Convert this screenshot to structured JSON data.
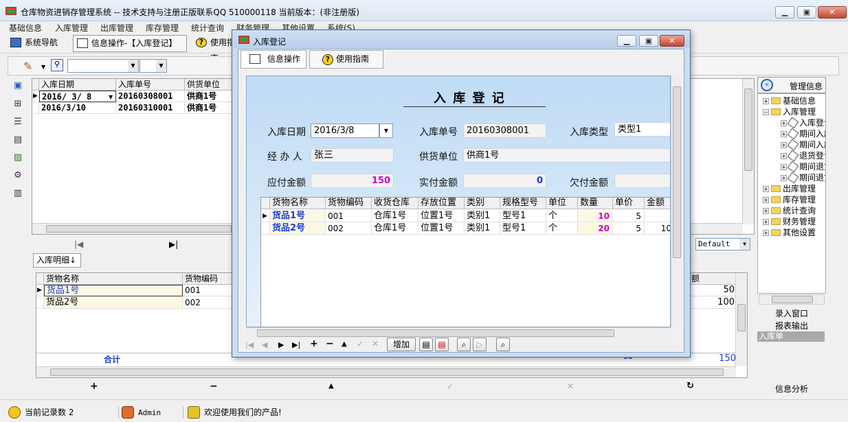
{
  "app": {
    "title": "仓库物资进销存管理系统 -- 技术支持与注册正版联系QQ 510000118   当前版本：(非注册版)"
  },
  "menu": [
    "基础信息",
    "入库管理",
    "出库管理",
    "库存管理",
    "统计查询",
    "财务管理",
    "其他设置",
    "系统(S)"
  ],
  "tabs": {
    "nav": "系统导航",
    "info": "信息操作-【入库登记】",
    "guide": "使用指南"
  },
  "master": {
    "headers": [
      "入库日期",
      "入库单号",
      "供货单位"
    ],
    "rows": [
      {
        "date": "2016/ 3/ 8",
        "no": "20160308001",
        "supplier": "供商1号"
      },
      {
        "date": "2016/3/10",
        "no": "20160310001",
        "supplier": "供商1号"
      }
    ]
  },
  "layout_select": {
    "value": "Default"
  },
  "detail": {
    "tab": "入库明细↓",
    "headers": [
      "货物名称",
      "货物编码",
      "额"
    ],
    "rows": [
      {
        "name": "货品1号",
        "code": "001",
        "amount": "50"
      },
      {
        "name": "货品2号",
        "code": "002",
        "amount": "100"
      }
    ],
    "total_label": "合计",
    "total_value": "150",
    "total_partial": "30"
  },
  "right_panel": {
    "title": "管理信息",
    "tree": [
      {
        "label": "基础信息",
        "level": 0,
        "type": "folder"
      },
      {
        "label": "入库管理",
        "level": 0,
        "type": "folder"
      },
      {
        "label": "入库登记",
        "level": 1,
        "type": "doc"
      },
      {
        "label": "期间入库",
        "level": 1,
        "type": "doc"
      },
      {
        "label": "期间入库",
        "level": 1,
        "type": "doc"
      },
      {
        "label": "退货登记",
        "level": 1,
        "type": "doc"
      },
      {
        "label": "期间退货",
        "level": 1,
        "type": "doc"
      },
      {
        "label": "期间退货",
        "level": 1,
        "type": "doc"
      },
      {
        "label": "出库管理",
        "level": 0,
        "type": "folder"
      },
      {
        "label": "库存管理",
        "level": 0,
        "type": "folder"
      },
      {
        "label": "统计查询",
        "level": 0,
        "type": "folder"
      },
      {
        "label": "财务管理",
        "level": 0,
        "type": "folder"
      },
      {
        "label": "其他设置",
        "level": 0,
        "type": "folder"
      }
    ],
    "buttons": [
      "录入窗口",
      "报表输出"
    ],
    "selected": "入库单",
    "bottom": "信息分析"
  },
  "status": {
    "records": "当前记录数 2",
    "user": "Admin",
    "welcome": "欢迎使用我们的产品!"
  },
  "dialog": {
    "title": "入库登记",
    "tab_info": "信息操作",
    "tab_guide": "使用指南",
    "form_title": "入 库 登 记",
    "labels": {
      "date": "入库日期",
      "no": "入库单号",
      "type": "入库类型",
      "handler": "经 办 人",
      "supplier": "供货单位",
      "payable": "应付金额",
      "paid": "实付金额",
      "owed": "欠付金额"
    },
    "values": {
      "date": "2016/3/8",
      "no": "20160308001",
      "type": "类型1",
      "handler": "张三",
      "supplier": "供商1号",
      "payable": "150",
      "paid": "0",
      "owed": ""
    },
    "grid_headers": [
      "货物名称",
      "货物编码",
      "收货仓库",
      "存放位置",
      "类别",
      "规格型号",
      "单位",
      "数量",
      "单价",
      "金额"
    ],
    "grid_rows": [
      {
        "name": "货品1号",
        "code": "001",
        "wh": "仓库1号",
        "pos": "位置1号",
        "cat": "类别1",
        "spec": "型号1",
        "unit": "个",
        "qty": "10",
        "price": "5",
        "amount": ""
      },
      {
        "name": "货品2号",
        "code": "002",
        "wh": "仓库1号",
        "pos": "位置1号",
        "cat": "类别1",
        "spec": "型号1",
        "unit": "个",
        "qty": "20",
        "price": "5",
        "amount": "10"
      }
    ],
    "add_button": "增加"
  },
  "colors": {
    "accent": "#1a3bd6",
    "magenta": "#cc00cc",
    "title_bg": "#dbe7f4",
    "close": "#c7452f"
  }
}
